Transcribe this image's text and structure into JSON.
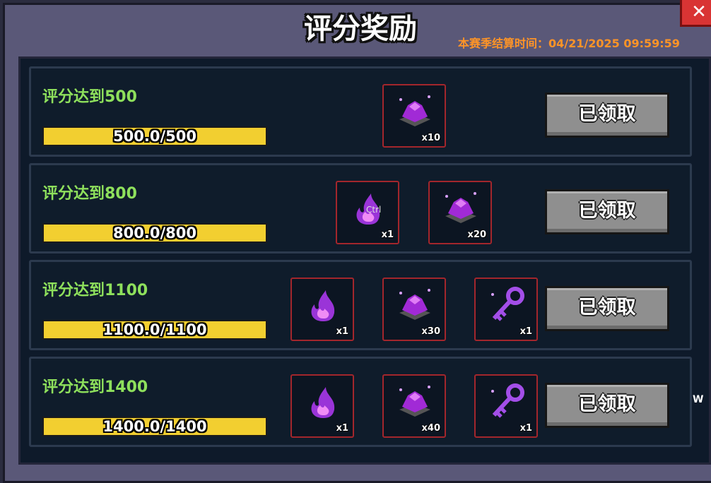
{
  "header": {
    "title": "评分奖励",
    "season_end": "本赛季结算时间：04/21/2025 09:59:59",
    "close_icon": "close-icon"
  },
  "colors": {
    "row_title": "#8ee05c",
    "progress": "#f2cf30",
    "season_text": "#ff9427",
    "item_border": "#a3262c"
  },
  "rows": [
    {
      "title": "评分达到500",
      "progress_text": "500.0/500",
      "progress_fraction": 1.0,
      "button_label": "已领取",
      "rewards": [
        {
          "icon": "purple-crystal-icon",
          "qty": "x10"
        }
      ]
    },
    {
      "title": "评分达到800",
      "progress_text": "800.0/800",
      "progress_fraction": 1.0,
      "button_label": "已领取",
      "rewards": [
        {
          "icon": "purple-flame-icon",
          "qty": "x1",
          "overlay": "Ctrl"
        },
        {
          "icon": "purple-crystal-icon",
          "qty": "x20"
        }
      ]
    },
    {
      "title": "评分达到1100",
      "progress_text": "1100.0/1100",
      "progress_fraction": 1.0,
      "button_label": "已领取",
      "rewards": [
        {
          "icon": "purple-flame-icon",
          "qty": "x1"
        },
        {
          "icon": "purple-crystal-icon",
          "qty": "x30"
        },
        {
          "icon": "purple-key-icon",
          "qty": "x1"
        }
      ]
    },
    {
      "title": "评分达到1400",
      "progress_text": "1400.0/1400",
      "progress_fraction": 1.0,
      "button_label": "已领取",
      "rewards": [
        {
          "icon": "purple-flame-icon",
          "qty": "x1"
        },
        {
          "icon": "purple-crystal-icon",
          "qty": "x40"
        },
        {
          "icon": "purple-key-icon",
          "qty": "x1"
        }
      ]
    }
  ],
  "side_hint": "W"
}
